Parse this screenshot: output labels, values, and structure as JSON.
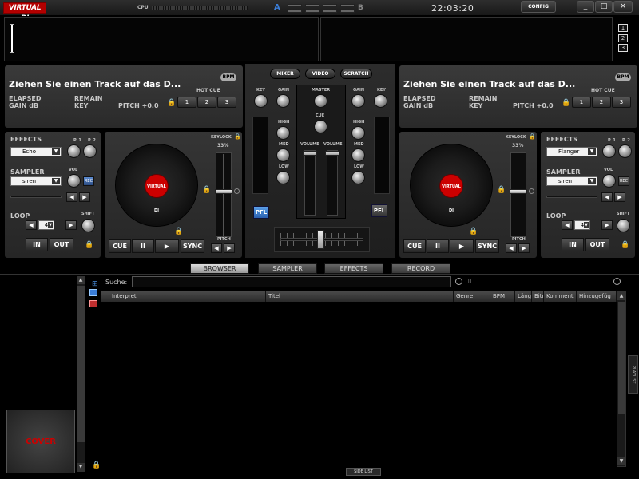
{
  "titlebar": {
    "logo": "VIRTUAL DJ",
    "cpu_label": "CPU",
    "deck_a": "A",
    "deck_b": "B",
    "clock": "22:03:20",
    "config": "CONFIG",
    "minimize": "_",
    "maximize": "□",
    "close": "×"
  },
  "wave": {
    "buttons": [
      "1",
      "2",
      "3"
    ]
  },
  "deck_left": {
    "track": "Ziehen Sie einen Track auf das D...",
    "bpm_label": "BPM",
    "elapsed": "ELAPSED",
    "remain": "REMAIN",
    "gain": "GAIN dB",
    "key": "KEY",
    "pitch": "PITCH +0.0",
    "hotcue": "HOT CUE",
    "hotcues": [
      "1",
      "2",
      "3"
    ],
    "effects_label": "EFFECTS",
    "effect": "Echo",
    "p1": "P. 1",
    "p2": "P. 2",
    "sampler_label": "SAMPLER",
    "sampler": "siren",
    "vol": "VOL",
    "rec": "REC",
    "loop_label": "LOOP",
    "loop_value": "4",
    "shift": "SHIFT",
    "in": "IN",
    "out": "OUT",
    "keylock": "KEYLOCK",
    "keylock_pct": "33%",
    "cue": "CUE",
    "pause": "II",
    "play": "▶",
    "sync": "SYNC",
    "pitch_label": "PITCH",
    "tt_label": "VIRTUAL DJ"
  },
  "deck_right": {
    "track": "Ziehen Sie einen Track auf das D...",
    "bpm_label": "BPM",
    "elapsed": "ELAPSED",
    "remain": "REMAIN",
    "gain": "GAIN dB",
    "key": "KEY",
    "pitch": "PITCH +0.0",
    "hotcue": "HOT CUE",
    "hotcues": [
      "1",
      "2",
      "3"
    ],
    "effects_label": "EFFECTS",
    "effect": "Flanger",
    "p1": "P. 1",
    "p2": "P. 2",
    "sampler_label": "SAMPLER",
    "sampler": "siren",
    "vol": "VOL",
    "rec": "REC",
    "loop_label": "LOOP",
    "loop_value": "4",
    "shift": "SHIFT",
    "in": "IN",
    "out": "OUT",
    "keylock": "KEYLOCK",
    "keylock_pct": "33%",
    "cue": "CUE",
    "pause": "II",
    "play": "▶",
    "sync": "SYNC",
    "pitch_label": "PITCH",
    "tt_label": "VIRTUAL DJ"
  },
  "mixer": {
    "tabs": [
      "MIXER",
      "VIDEO",
      "SCRATCH"
    ],
    "key": "KEY",
    "gain": "GAIN",
    "master": "MASTER",
    "high": "HIGH",
    "cue": "CUE",
    "med": "MED",
    "volume": "VOLUME",
    "low": "LOW",
    "pfl": "PFL"
  },
  "browser": {
    "tabs": [
      "BROWSER",
      "SAMPLER",
      "EFFECTS",
      "RECORD"
    ],
    "search_label": "Suche:",
    "columns": [
      "Interpret",
      "Titel",
      "Genre",
      "BPM",
      "Läng",
      "Bitr",
      "Komment",
      "Hinzugefüg"
    ],
    "cover": "COVER",
    "playlist": "PLAYLIST",
    "sidelist": "SIDE LIST"
  }
}
